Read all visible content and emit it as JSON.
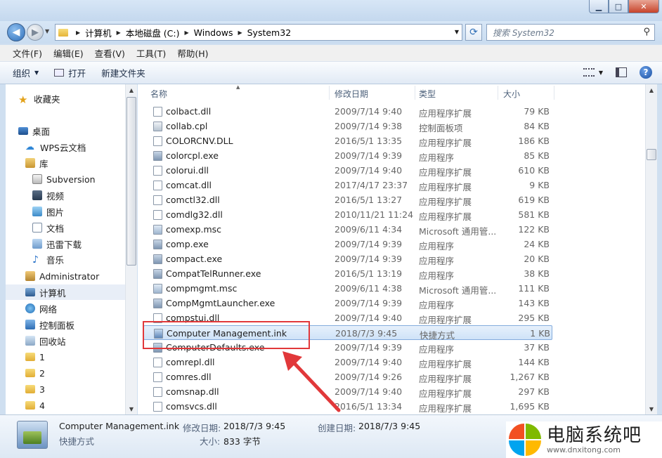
{
  "window": {
    "min_glyph": "▁",
    "max_glyph": "□",
    "close_glyph": "✕"
  },
  "address": {
    "crumbs": [
      "计算机",
      "本地磁盘 (C:)",
      "Windows",
      "System32"
    ],
    "search_placeholder": "搜索 System32"
  },
  "menu": [
    "文件(F)",
    "编辑(E)",
    "查看(V)",
    "工具(T)",
    "帮助(H)"
  ],
  "commands": {
    "organize": "组织",
    "open": "打开",
    "new_folder": "新建文件夹"
  },
  "nav": [
    {
      "label": "收藏夹",
      "icon": "star-icon"
    },
    {
      "label": "桌面",
      "icon": "desktop-icon"
    },
    {
      "label": "WPS云文档",
      "icon": "cloud-icon"
    },
    {
      "label": "库",
      "icon": "library-icon"
    },
    {
      "label": "Subversion",
      "icon": "subversion-icon"
    },
    {
      "label": "视频",
      "icon": "video-icon"
    },
    {
      "label": "图片",
      "icon": "pictures-icon"
    },
    {
      "label": "文档",
      "icon": "documents-icon"
    },
    {
      "label": "迅雷下载",
      "icon": "download-icon"
    },
    {
      "label": "音乐",
      "icon": "music-icon"
    },
    {
      "label": "Administrator",
      "icon": "user-icon"
    },
    {
      "label": "计算机",
      "icon": "computer-icon"
    },
    {
      "label": "网络",
      "icon": "network-icon"
    },
    {
      "label": "控制面板",
      "icon": "control-panel-icon"
    },
    {
      "label": "回收站",
      "icon": "recycle-bin-icon"
    },
    {
      "label": "1",
      "icon": "folder-icon"
    },
    {
      "label": "2",
      "icon": "folder-icon"
    },
    {
      "label": "3",
      "icon": "folder-icon"
    },
    {
      "label": "4",
      "icon": "folder-icon"
    }
  ],
  "columns": {
    "name": "名称",
    "date": "修改日期",
    "type": "类型",
    "size": "大小"
  },
  "files": [
    {
      "name": "colbact.dll",
      "date": "2009/7/14 9:40",
      "type": "应用程序扩展",
      "size": "79 KB",
      "kind": "dll"
    },
    {
      "name": "collab.cpl",
      "date": "2009/7/14 9:38",
      "type": "控制面板项",
      "size": "84 KB",
      "kind": "cpl"
    },
    {
      "name": "COLORCNV.DLL",
      "date": "2016/5/1 13:35",
      "type": "应用程序扩展",
      "size": "186 KB",
      "kind": "dll"
    },
    {
      "name": "colorcpl.exe",
      "date": "2009/7/14 9:39",
      "type": "应用程序",
      "size": "85 KB",
      "kind": "exe"
    },
    {
      "name": "colorui.dll",
      "date": "2009/7/14 9:40",
      "type": "应用程序扩展",
      "size": "610 KB",
      "kind": "dll"
    },
    {
      "name": "comcat.dll",
      "date": "2017/4/17 23:37",
      "type": "应用程序扩展",
      "size": "9 KB",
      "kind": "dll"
    },
    {
      "name": "comctl32.dll",
      "date": "2016/5/1 13:27",
      "type": "应用程序扩展",
      "size": "619 KB",
      "kind": "dll"
    },
    {
      "name": "comdlg32.dll",
      "date": "2010/11/21 11:24",
      "type": "应用程序扩展",
      "size": "581 KB",
      "kind": "dll"
    },
    {
      "name": "comexp.msc",
      "date": "2009/6/11 4:34",
      "type": "Microsoft 通用管...",
      "size": "122 KB",
      "kind": "msc"
    },
    {
      "name": "comp.exe",
      "date": "2009/7/14 9:39",
      "type": "应用程序",
      "size": "24 KB",
      "kind": "exe"
    },
    {
      "name": "compact.exe",
      "date": "2009/7/14 9:39",
      "type": "应用程序",
      "size": "20 KB",
      "kind": "exe"
    },
    {
      "name": "CompatTelRunner.exe",
      "date": "2016/5/1 13:19",
      "type": "应用程序",
      "size": "38 KB",
      "kind": "exe"
    },
    {
      "name": "compmgmt.msc",
      "date": "2009/6/11 4:38",
      "type": "Microsoft 通用管...",
      "size": "111 KB",
      "kind": "msc"
    },
    {
      "name": "CompMgmtLauncher.exe",
      "date": "2009/7/14 9:39",
      "type": "应用程序",
      "size": "143 KB",
      "kind": "exe"
    },
    {
      "name": "compstui.dll",
      "date": "2009/7/14 9:40",
      "type": "应用程序扩展",
      "size": "295 KB",
      "kind": "dll"
    },
    {
      "name": "Computer Management.ink",
      "date": "2018/7/3 9:45",
      "type": "快捷方式",
      "size": "1 KB",
      "kind": "lnk"
    },
    {
      "name": "ComputerDefaults.exe",
      "date": "2009/7/14 9:39",
      "type": "应用程序",
      "size": "37 KB",
      "kind": "exe"
    },
    {
      "name": "comrepl.dll",
      "date": "2009/7/14 9:40",
      "type": "应用程序扩展",
      "size": "144 KB",
      "kind": "dll"
    },
    {
      "name": "comres.dll",
      "date": "2009/7/14 9:26",
      "type": "应用程序扩展",
      "size": "1,267 KB",
      "kind": "dll"
    },
    {
      "name": "comsnap.dll",
      "date": "2009/7/14 9:40",
      "type": "应用程序扩展",
      "size": "297 KB",
      "kind": "dll"
    },
    {
      "name": "comsvcs.dll",
      "date": "2016/5/1 13:34",
      "type": "应用程序扩展",
      "size": "1,695 KB",
      "kind": "dll"
    }
  ],
  "selected_index": 15,
  "details": {
    "name": "Computer Management.ink",
    "kind": "快捷方式",
    "modified_label": "修改日期:",
    "modified_value": "2018/7/3 9:45",
    "created_label": "创建日期:",
    "created_value": "2018/7/3 9:45",
    "size_label": "大小:",
    "size_value": "833 字节"
  },
  "watermark": {
    "title": "电脑系统吧",
    "url": "www.dnxitong.com"
  },
  "colors": {
    "highlight": "#e1383a",
    "selection": "#cfe3f8"
  }
}
